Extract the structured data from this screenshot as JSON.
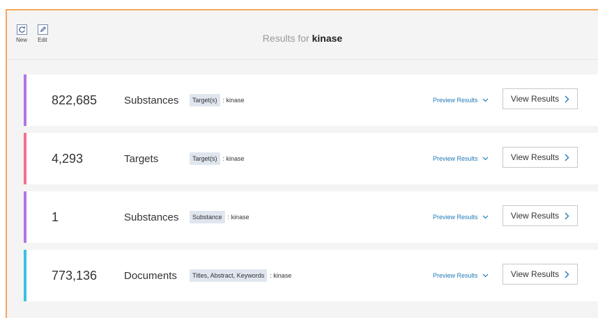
{
  "toolbar": {
    "new_label": "New",
    "edit_label": "Edit"
  },
  "header": {
    "prefix": "Results for",
    "query": "kinase"
  },
  "results": [
    {
      "count": "822,685",
      "kind": "Substances",
      "chip": "Target(s)",
      "sep": ":",
      "term": "kinase",
      "preview": "Preview Results",
      "view": "View Results",
      "color": "#b077e0"
    },
    {
      "count": "4,293",
      "kind": "Targets",
      "chip": "Target(s)",
      "sep": ":",
      "term": "kinase",
      "preview": "Preview Results",
      "view": "View Results",
      "color": "#f0728c"
    },
    {
      "count": "1",
      "kind": "Substances",
      "chip": "Substance",
      "sep": ":",
      "term": "kinase",
      "preview": "Preview Results",
      "view": "View Results",
      "color": "#b077e0"
    },
    {
      "count": "773,136",
      "kind": "Documents",
      "chip": "Titles, Abstract, Keywords",
      "sep": ":",
      "term": "kinase",
      "preview": "Preview Results",
      "view": "View Results",
      "color": "#39c3e0"
    }
  ],
  "colors": {
    "accent_link": "#1f7ab8",
    "frame_border": "#f5a65b"
  },
  "icons": {
    "new": "refresh-icon",
    "edit": "pencil-icon",
    "preview": "chevron-down-icon",
    "view": "chevron-right-icon"
  }
}
